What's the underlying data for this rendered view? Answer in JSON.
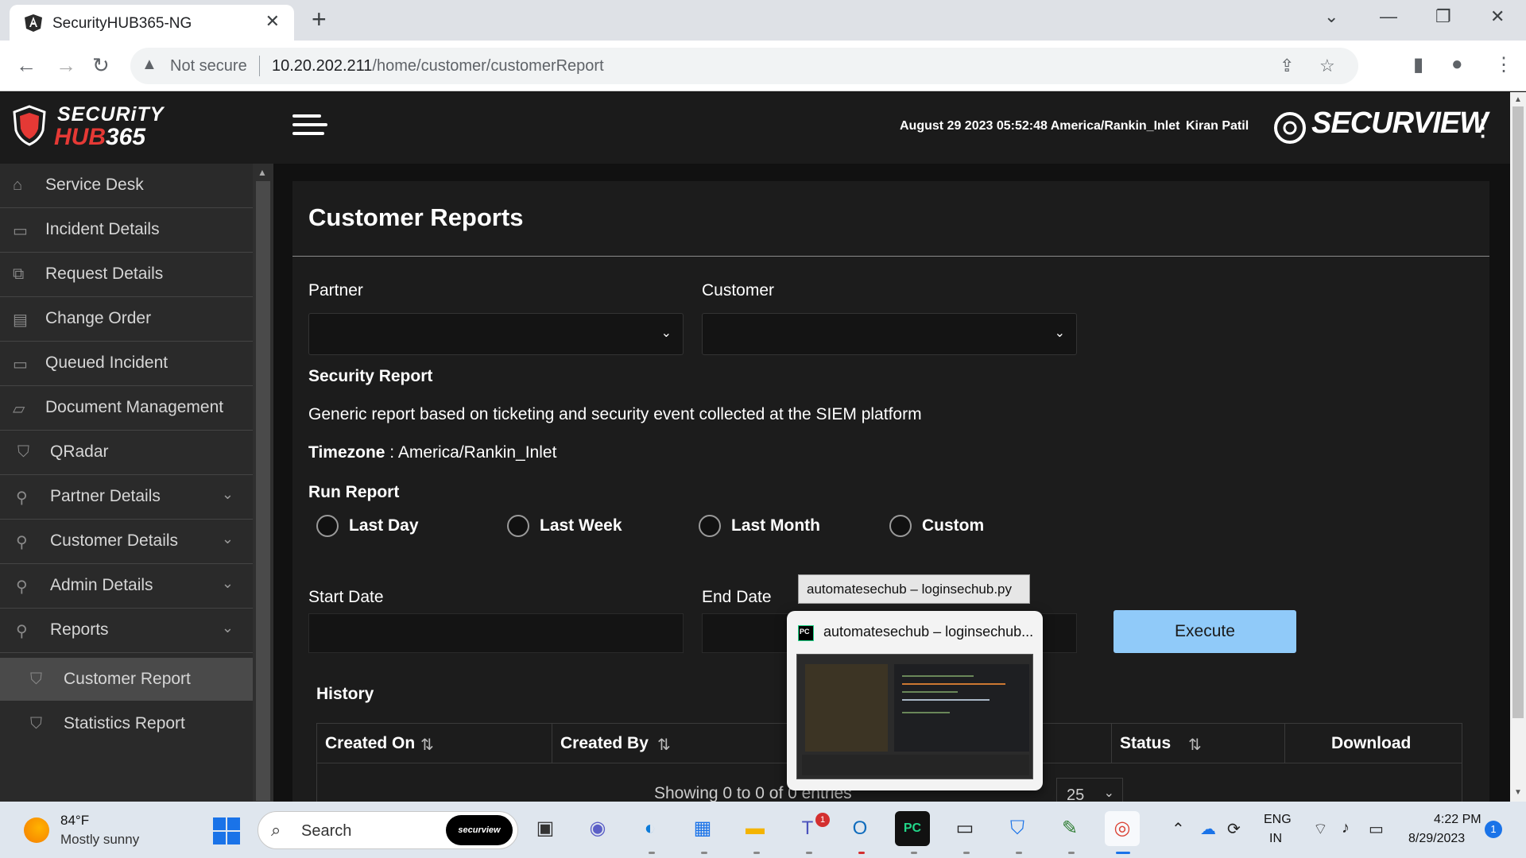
{
  "browser": {
    "tab_title": "SecurityHUB365-NG",
    "not_secure": "Not secure",
    "url_host": "10.20.202.211",
    "url_path": "/home/customer/customerReport"
  },
  "header": {
    "logo_line1": "SECURiTY",
    "logo_line2a": "HUB",
    "logo_line2b": "365",
    "datetime": "August 29 2023 05:52:48 America/Rankin_Inlet",
    "user": "Kiran Patil",
    "brand": "SECURVIEW"
  },
  "sidebar": {
    "items": [
      {
        "label": "Service Desk",
        "icon": "home-icon"
      },
      {
        "label": "Incident Details",
        "icon": "ticket-icon"
      },
      {
        "label": "Request Details",
        "icon": "copy-icon"
      },
      {
        "label": "Change Order",
        "icon": "briefcase-icon"
      },
      {
        "label": "Queued Incident",
        "icon": "ticket-icon"
      },
      {
        "label": "Document Management",
        "icon": "folder-icon"
      },
      {
        "label": "QRadar",
        "icon": "shield-icon"
      },
      {
        "label": "Partner Details",
        "icon": "sitemap-icon"
      },
      {
        "label": "Customer Details",
        "icon": "sitemap-icon"
      },
      {
        "label": "Admin Details",
        "icon": "sitemap-icon"
      },
      {
        "label": "Reports",
        "icon": "sitemap-icon"
      },
      {
        "label": "Customer Report",
        "icon": "shield-icon"
      },
      {
        "label": "Statistics Report",
        "icon": "shield-icon"
      }
    ]
  },
  "main": {
    "title": "Customer Reports",
    "partner_label": "Partner",
    "customer_label": "Customer",
    "security_report_label": "Security Report",
    "description": "Generic report based on ticketing and security event collected at the SIEM platform",
    "timezone_label": "Timezone",
    "timezone_sep": " : ",
    "timezone_value": "America/Rankin_Inlet",
    "run_report_label": "Run Report",
    "radios": [
      "Last Day",
      "Last Week",
      "Last Month",
      "Custom"
    ],
    "start_date_label": "Start Date",
    "end_date_label": "End Date",
    "execute_label": "Execute",
    "history_label": "History",
    "columns": [
      "Created On",
      "Created By",
      "",
      "Status",
      "Download"
    ],
    "showing": "Showing 0 to 0 of 0 entries",
    "page_size": "25"
  },
  "popup": {
    "tooltip": "automatesechub – loginsechub.py",
    "title": "automatesechub – loginsechub...",
    "app_icon": "PC"
  },
  "taskbar": {
    "temp": "84°F",
    "weather": "Mostly sunny",
    "search": "Search",
    "search_badge": "securview",
    "teams_badge": "1",
    "lang1": "ENG",
    "lang2": "IN",
    "time": "4:22 PM",
    "date": "8/29/2023",
    "notifications": "1"
  },
  "colors": {
    "execute": "#90caf9",
    "header_bg": "#1b1b1b",
    "sidebar_bg": "#2a2a2a",
    "logo_red": "#e53935"
  }
}
